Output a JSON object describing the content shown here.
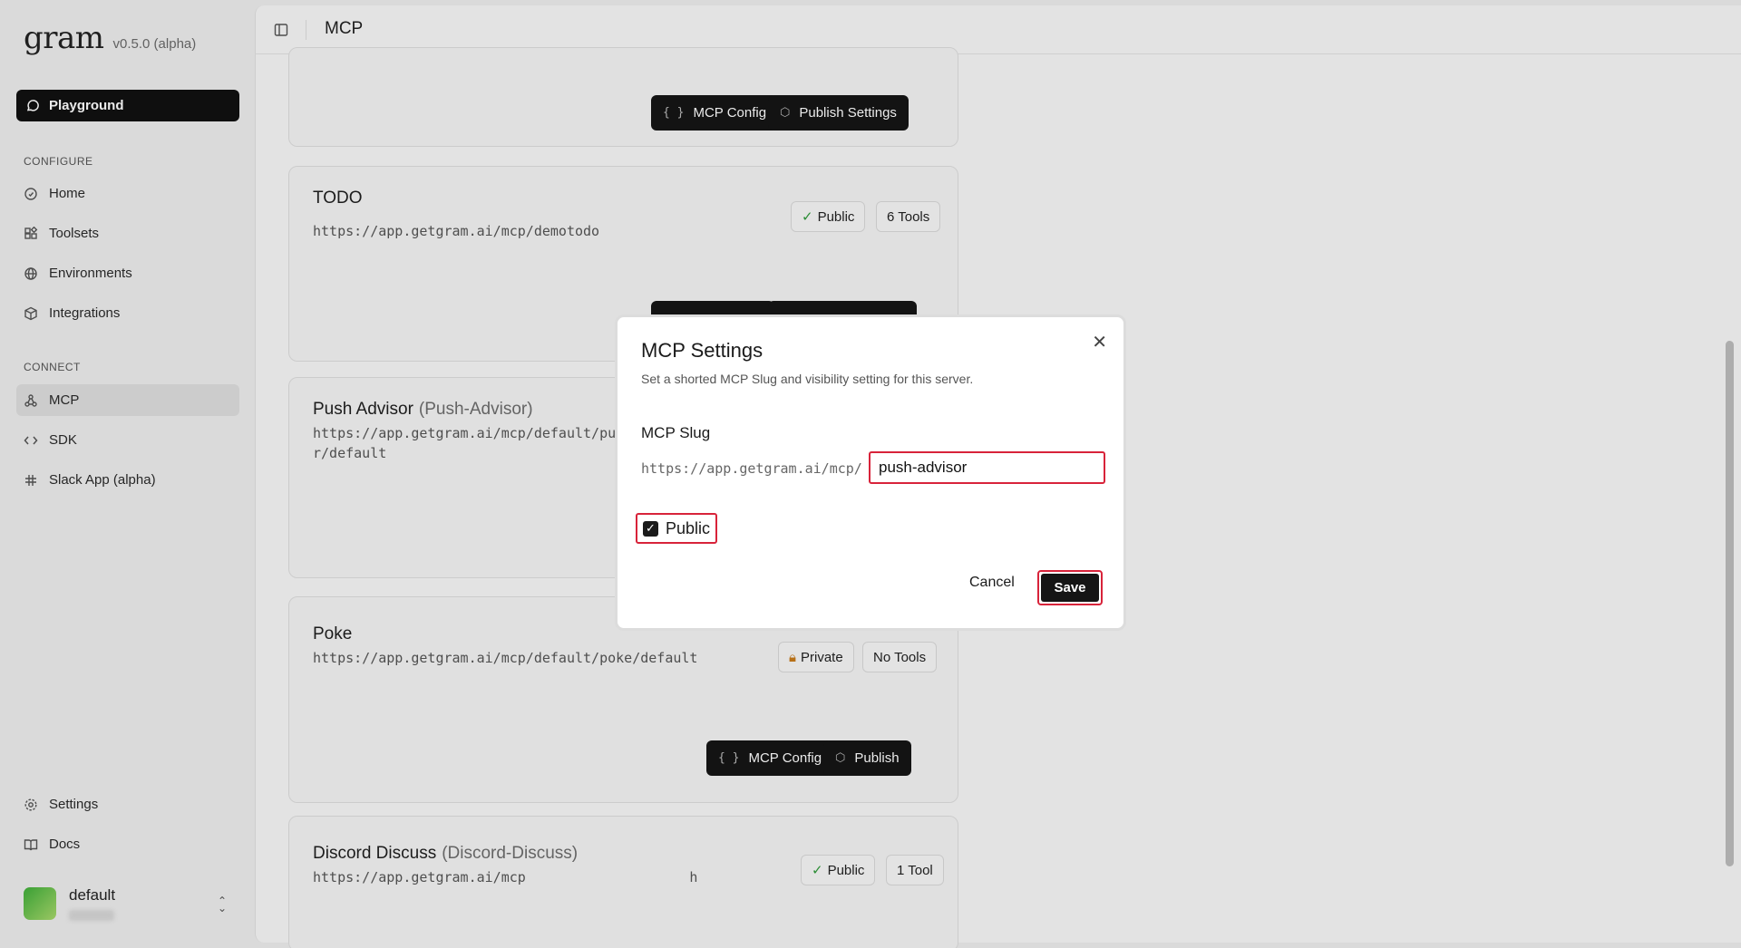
{
  "app": {
    "name": "gram",
    "version": "v0.5.0 (alpha)"
  },
  "sidebar": {
    "playground": "Playground",
    "configure_label": "CONFIGURE",
    "configure_items": [
      {
        "label": "Home",
        "icon": "home-icon"
      },
      {
        "label": "Toolsets",
        "icon": "toolsets-icon"
      },
      {
        "label": "Environments",
        "icon": "globe-icon"
      },
      {
        "label": "Integrations",
        "icon": "package-icon"
      }
    ],
    "connect_label": "CONNECT",
    "connect_items": [
      {
        "label": "MCP",
        "icon": "network-icon",
        "active": true
      },
      {
        "label": "SDK",
        "icon": "code-icon"
      },
      {
        "label": "Slack App (alpha)",
        "icon": "slack-icon"
      }
    ],
    "bottom_items": [
      {
        "label": "Settings",
        "icon": "gear-icon"
      },
      {
        "label": "Docs",
        "icon": "book-icon"
      }
    ],
    "account": {
      "name": "default"
    }
  },
  "header": {
    "title": "MCP"
  },
  "cards": [
    {
      "buttons": {
        "config": "MCP Config",
        "publish": "Publish Settings"
      }
    },
    {
      "title": "TODO",
      "url": "https://app.getgram.ai/mcp/demotodo",
      "visibility": "Public",
      "tools": "6 Tools"
    },
    {
      "title": "Push Advisor",
      "slug": "(Push-Advisor)",
      "url": "https://app.getgram.ai/mcp/default/push-advisor/default"
    },
    {
      "title": "Poke",
      "url": "https://app.getgram.ai/mcp/default/poke/default",
      "visibility": "Private",
      "tools": "No Tools",
      "buttons": {
        "config": "MCP Config",
        "publish": "Publish"
      }
    },
    {
      "title": "Discord Discuss",
      "slug": "(Discord-Discuss)",
      "url": "https://app.getgram.ai/mcp                    h",
      "visibility": "Public",
      "tools": "1 Tool"
    }
  ],
  "modal": {
    "title": "MCP Settings",
    "subtitle": "Set a shorted MCP Slug and visibility setting for this server.",
    "slug_label": "MCP Slug",
    "slug_prefix": "https://app.getgram.ai/mcp/",
    "slug_value": "push-advisor",
    "public_label": "Public",
    "public_checked": true,
    "cancel": "Cancel",
    "save": "Save"
  }
}
